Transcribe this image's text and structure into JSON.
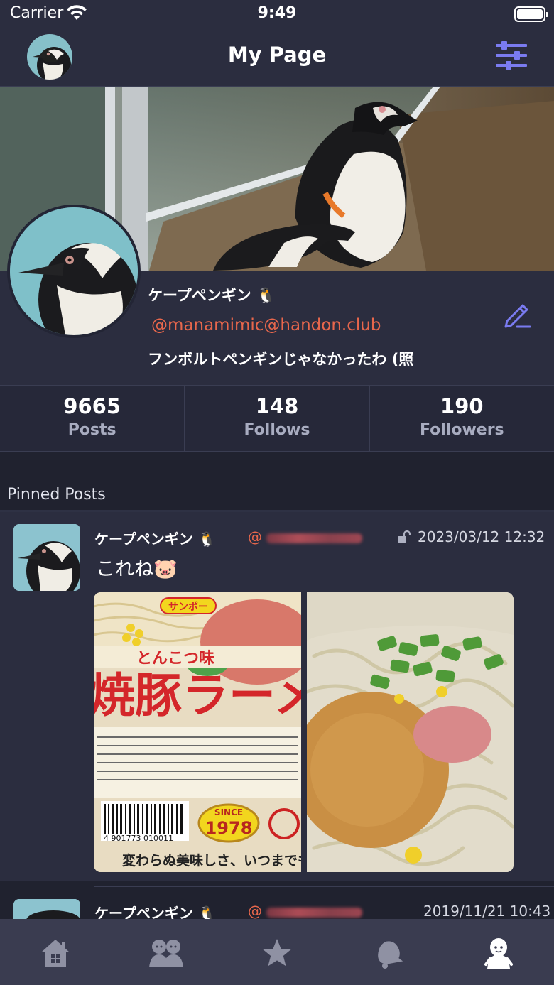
{
  "status_bar": {
    "carrier": "Carrier",
    "time": "9:49"
  },
  "nav": {
    "title": "My Page"
  },
  "profile": {
    "display_name": "ケープペンギン 🐧",
    "handle": "@manamimic@handon.club",
    "bio": "フンボルトペンギンじゃなかったわ (照"
  },
  "stats": [
    {
      "value": "9665",
      "label": "Posts"
    },
    {
      "value": "148",
      "label": "Follows"
    },
    {
      "value": "190",
      "label": "Followers"
    }
  ],
  "pinned_heading": "Pinned Posts",
  "posts": [
    {
      "name": "ケープペンギン 🐧",
      "handle_prefix": "@",
      "time": "2023/03/12 12:32",
      "text": "これね🐷"
    },
    {
      "name": "ケープペンギン 🐧",
      "handle_prefix": "@",
      "time": "2019/11/21 10:43"
    }
  ],
  "media_labels": {
    "brand": "サンポー",
    "flavor": "とんこつ味",
    "product": "焼豚ラーメ",
    "since": "SINCE",
    "year": "1978",
    "barcode": "4 901773 010011",
    "tagline": "変わらぬ美味しさ、いつまでも。"
  },
  "tabs": [
    {
      "icon": "home-icon"
    },
    {
      "icon": "people-icon"
    },
    {
      "icon": "star-icon"
    },
    {
      "icon": "bell-icon"
    },
    {
      "icon": "profile-icon",
      "active": true
    }
  ],
  "colors": {
    "accent": "#7a7bf0",
    "handle": "#e8674c",
    "tab_inactive": "#8f91a3",
    "tab_active": "#ffffff"
  }
}
